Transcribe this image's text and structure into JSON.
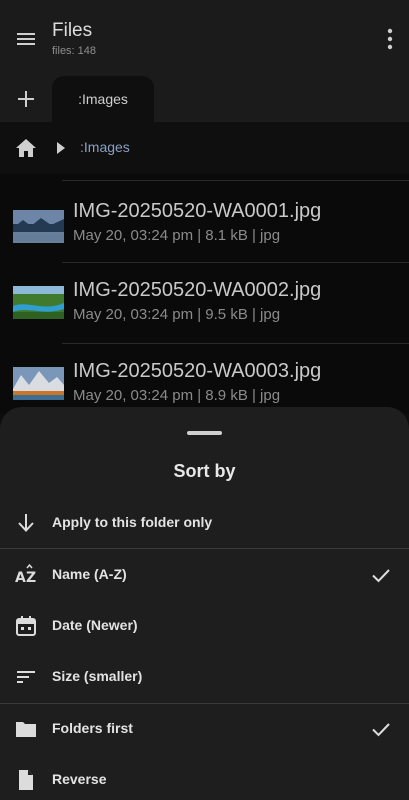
{
  "app": {
    "title": "Files",
    "subtitle": "files: 148"
  },
  "tabs": [
    {
      "label": ":Images"
    }
  ],
  "breadcrumb": {
    "current": ":Images"
  },
  "files": [
    {
      "name": "IMG-20250520-WA0001.jpg",
      "meta": "May 20, 03:24 pm | 8.1 kB | jpg"
    },
    {
      "name": "IMG-20250520-WA0002.jpg",
      "meta": "May 20, 03:24 pm | 9.5 kB | jpg"
    },
    {
      "name": "IMG-20250520-WA0003.jpg",
      "meta": "May 20, 03:24 pm | 8.9 kB | jpg"
    }
  ],
  "sort_sheet": {
    "title": "Sort by",
    "apply_label": "Apply to this folder only",
    "options": [
      {
        "label": "Name (A-Z)",
        "icon": "sort-alpha-icon",
        "checked": true
      },
      {
        "label": "Date (Newer)",
        "icon": "calendar-icon",
        "checked": false
      },
      {
        "label": "Size (smaller)",
        "icon": "sort-lines-icon",
        "checked": false
      }
    ],
    "toggles": [
      {
        "label": "Folders first",
        "icon": "folder-icon",
        "checked": true
      },
      {
        "label": "Reverse",
        "icon": "file-icon",
        "checked": false
      }
    ]
  },
  "colors": {
    "background": "#0d0d0d",
    "bar": "#1b1b1b",
    "sheet": "#1e1e1e",
    "accent_text": "#8aa0c0"
  }
}
